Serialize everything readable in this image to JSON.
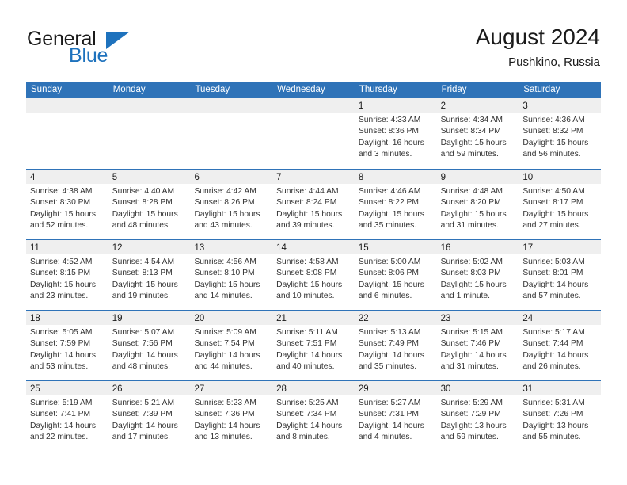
{
  "brand": {
    "name_top": "General",
    "name_bottom": "Blue",
    "accent_color": "#1e72bd"
  },
  "header": {
    "title": "August 2024",
    "subtitle": "Pushkino, Russia"
  },
  "calendar": {
    "header_bg": "#2f73b8",
    "day_strip_bg": "#efefef",
    "weekdays": [
      "Sunday",
      "Monday",
      "Tuesday",
      "Wednesday",
      "Thursday",
      "Friday",
      "Saturday"
    ],
    "weeks": [
      [
        {
          "day": "",
          "lines": []
        },
        {
          "day": "",
          "lines": []
        },
        {
          "day": "",
          "lines": []
        },
        {
          "day": "",
          "lines": []
        },
        {
          "day": "1",
          "lines": [
            "Sunrise: 4:33 AM",
            "Sunset: 8:36 PM",
            "Daylight: 16 hours",
            "and 3 minutes."
          ]
        },
        {
          "day": "2",
          "lines": [
            "Sunrise: 4:34 AM",
            "Sunset: 8:34 PM",
            "Daylight: 15 hours",
            "and 59 minutes."
          ]
        },
        {
          "day": "3",
          "lines": [
            "Sunrise: 4:36 AM",
            "Sunset: 8:32 PM",
            "Daylight: 15 hours",
            "and 56 minutes."
          ]
        }
      ],
      [
        {
          "day": "4",
          "lines": [
            "Sunrise: 4:38 AM",
            "Sunset: 8:30 PM",
            "Daylight: 15 hours",
            "and 52 minutes."
          ]
        },
        {
          "day": "5",
          "lines": [
            "Sunrise: 4:40 AM",
            "Sunset: 8:28 PM",
            "Daylight: 15 hours",
            "and 48 minutes."
          ]
        },
        {
          "day": "6",
          "lines": [
            "Sunrise: 4:42 AM",
            "Sunset: 8:26 PM",
            "Daylight: 15 hours",
            "and 43 minutes."
          ]
        },
        {
          "day": "7",
          "lines": [
            "Sunrise: 4:44 AM",
            "Sunset: 8:24 PM",
            "Daylight: 15 hours",
            "and 39 minutes."
          ]
        },
        {
          "day": "8",
          "lines": [
            "Sunrise: 4:46 AM",
            "Sunset: 8:22 PM",
            "Daylight: 15 hours",
            "and 35 minutes."
          ]
        },
        {
          "day": "9",
          "lines": [
            "Sunrise: 4:48 AM",
            "Sunset: 8:20 PM",
            "Daylight: 15 hours",
            "and 31 minutes."
          ]
        },
        {
          "day": "10",
          "lines": [
            "Sunrise: 4:50 AM",
            "Sunset: 8:17 PM",
            "Daylight: 15 hours",
            "and 27 minutes."
          ]
        }
      ],
      [
        {
          "day": "11",
          "lines": [
            "Sunrise: 4:52 AM",
            "Sunset: 8:15 PM",
            "Daylight: 15 hours",
            "and 23 minutes."
          ]
        },
        {
          "day": "12",
          "lines": [
            "Sunrise: 4:54 AM",
            "Sunset: 8:13 PM",
            "Daylight: 15 hours",
            "and 19 minutes."
          ]
        },
        {
          "day": "13",
          "lines": [
            "Sunrise: 4:56 AM",
            "Sunset: 8:10 PM",
            "Daylight: 15 hours",
            "and 14 minutes."
          ]
        },
        {
          "day": "14",
          "lines": [
            "Sunrise: 4:58 AM",
            "Sunset: 8:08 PM",
            "Daylight: 15 hours",
            "and 10 minutes."
          ]
        },
        {
          "day": "15",
          "lines": [
            "Sunrise: 5:00 AM",
            "Sunset: 8:06 PM",
            "Daylight: 15 hours",
            "and 6 minutes."
          ]
        },
        {
          "day": "16",
          "lines": [
            "Sunrise: 5:02 AM",
            "Sunset: 8:03 PM",
            "Daylight: 15 hours",
            "and 1 minute."
          ]
        },
        {
          "day": "17",
          "lines": [
            "Sunrise: 5:03 AM",
            "Sunset: 8:01 PM",
            "Daylight: 14 hours",
            "and 57 minutes."
          ]
        }
      ],
      [
        {
          "day": "18",
          "lines": [
            "Sunrise: 5:05 AM",
            "Sunset: 7:59 PM",
            "Daylight: 14 hours",
            "and 53 minutes."
          ]
        },
        {
          "day": "19",
          "lines": [
            "Sunrise: 5:07 AM",
            "Sunset: 7:56 PM",
            "Daylight: 14 hours",
            "and 48 minutes."
          ]
        },
        {
          "day": "20",
          "lines": [
            "Sunrise: 5:09 AM",
            "Sunset: 7:54 PM",
            "Daylight: 14 hours",
            "and 44 minutes."
          ]
        },
        {
          "day": "21",
          "lines": [
            "Sunrise: 5:11 AM",
            "Sunset: 7:51 PM",
            "Daylight: 14 hours",
            "and 40 minutes."
          ]
        },
        {
          "day": "22",
          "lines": [
            "Sunrise: 5:13 AM",
            "Sunset: 7:49 PM",
            "Daylight: 14 hours",
            "and 35 minutes."
          ]
        },
        {
          "day": "23",
          "lines": [
            "Sunrise: 5:15 AM",
            "Sunset: 7:46 PM",
            "Daylight: 14 hours",
            "and 31 minutes."
          ]
        },
        {
          "day": "24",
          "lines": [
            "Sunrise: 5:17 AM",
            "Sunset: 7:44 PM",
            "Daylight: 14 hours",
            "and 26 minutes."
          ]
        }
      ],
      [
        {
          "day": "25",
          "lines": [
            "Sunrise: 5:19 AM",
            "Sunset: 7:41 PM",
            "Daylight: 14 hours",
            "and 22 minutes."
          ]
        },
        {
          "day": "26",
          "lines": [
            "Sunrise: 5:21 AM",
            "Sunset: 7:39 PM",
            "Daylight: 14 hours",
            "and 17 minutes."
          ]
        },
        {
          "day": "27",
          "lines": [
            "Sunrise: 5:23 AM",
            "Sunset: 7:36 PM",
            "Daylight: 14 hours",
            "and 13 minutes."
          ]
        },
        {
          "day": "28",
          "lines": [
            "Sunrise: 5:25 AM",
            "Sunset: 7:34 PM",
            "Daylight: 14 hours",
            "and 8 minutes."
          ]
        },
        {
          "day": "29",
          "lines": [
            "Sunrise: 5:27 AM",
            "Sunset: 7:31 PM",
            "Daylight: 14 hours",
            "and 4 minutes."
          ]
        },
        {
          "day": "30",
          "lines": [
            "Sunrise: 5:29 AM",
            "Sunset: 7:29 PM",
            "Daylight: 13 hours",
            "and 59 minutes."
          ]
        },
        {
          "day": "31",
          "lines": [
            "Sunrise: 5:31 AM",
            "Sunset: 7:26 PM",
            "Daylight: 13 hours",
            "and 55 minutes."
          ]
        }
      ]
    ]
  }
}
